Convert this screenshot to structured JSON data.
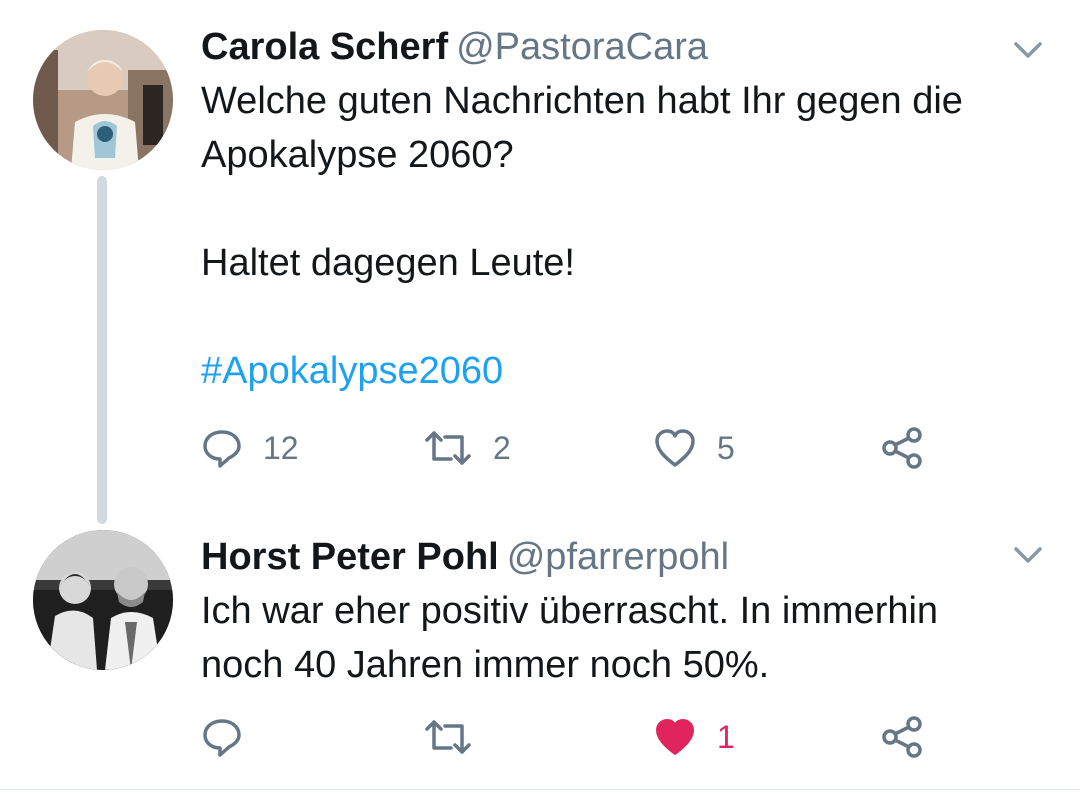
{
  "tweets": [
    {
      "name": "Carola Scherf",
      "handle": "@PastoraCara",
      "lines": [
        "Welche guten Nachrichten habt Ihr gegen die",
        "Apokalypse 2060?",
        "",
        "Haltet dagegen Leute!",
        ""
      ],
      "hashtag": "#Apokalypse2060",
      "replies": "12",
      "retweets": "2",
      "likes": "5",
      "liked": false
    },
    {
      "name": "Horst Peter Pohl",
      "handle": "@pfarrerpohl",
      "lines": [
        "Ich war eher positiv überrascht. In immerhin",
        "noch 40 Jahren immer noch 50%."
      ],
      "replies": "",
      "retweets": "",
      "likes": "1",
      "liked": true
    }
  ],
  "icons": {
    "reply": "reply-icon",
    "retweet": "retweet-icon",
    "like": "heart-icon",
    "share": "share-icon",
    "menu": "chevron-down-icon"
  },
  "colors": {
    "text": "#14171a",
    "secondary": "#657786",
    "link": "#1da1f2",
    "like": "#e0245e",
    "thread_line": "#cfd9de"
  }
}
